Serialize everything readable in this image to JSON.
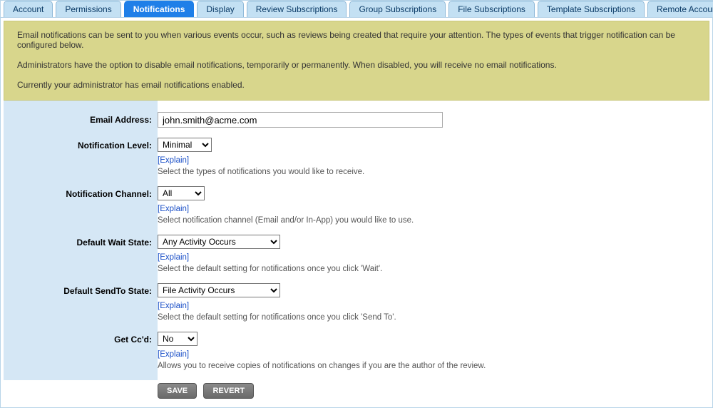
{
  "tabs": [
    {
      "label": "Account",
      "active": false
    },
    {
      "label": "Permissions",
      "active": false
    },
    {
      "label": "Notifications",
      "active": true
    },
    {
      "label": "Display",
      "active": false
    },
    {
      "label": "Review Subscriptions",
      "active": false
    },
    {
      "label": "Group Subscriptions",
      "active": false
    },
    {
      "label": "File Subscriptions",
      "active": false
    },
    {
      "label": "Template Subscriptions",
      "active": false
    },
    {
      "label": "Remote Accounts",
      "active": false
    }
  ],
  "notice": {
    "line1": "Email notifications can be sent to you when various events occur, such as reviews being created that require your attention. The types of events that trigger notification can be configured below.",
    "line2": "Administrators have the option to disable email notifications, temporarily or permanently. When disabled, you will receive no email notifications.",
    "line3": "Currently your administrator has email notifications enabled."
  },
  "form": {
    "email": {
      "label": "Email Address:",
      "value": "john.smith@acme.com"
    },
    "notificationLevel": {
      "label": "Notification Level:",
      "value": "Minimal",
      "options": [
        "Minimal"
      ],
      "explain": "[Explain]",
      "hint": "Select the types of notifications you would like to receive."
    },
    "notificationChannel": {
      "label": "Notification Channel:",
      "value": "All",
      "options": [
        "All"
      ],
      "explain": "[Explain]",
      "hint": "Select notification channel (Email and/or In-App) you would like to use."
    },
    "defaultWaitState": {
      "label": "Default Wait State:",
      "value": "Any Activity Occurs",
      "options": [
        "Any Activity Occurs"
      ],
      "explain": "[Explain]",
      "hint": "Select the default setting for notifications once you click 'Wait'."
    },
    "defaultSendToState": {
      "label": "Default SendTo State:",
      "value": "File Activity Occurs",
      "options": [
        "File Activity Occurs"
      ],
      "explain": "[Explain]",
      "hint": "Select the default setting for notifications once you click 'Send To'."
    },
    "getCcd": {
      "label": "Get Cc'd:",
      "value": "No",
      "options": [
        "No"
      ],
      "explain": "[Explain]",
      "hint": "Allows you to receive copies of notifications on changes if you are the author of the review."
    }
  },
  "buttons": {
    "save": "SAVE",
    "revert": "REVERT"
  }
}
